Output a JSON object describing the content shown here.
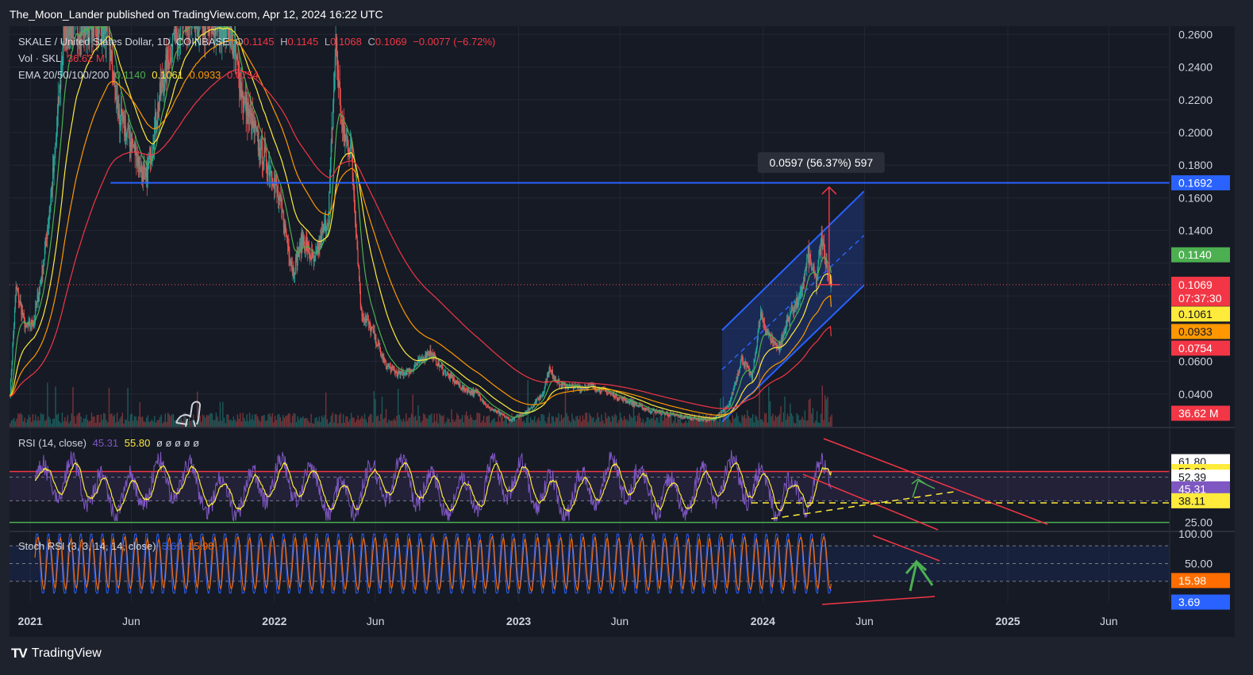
{
  "header": {
    "text": "The_Moon_Lander published on TradingView.com, Apr 12, 2024 16:22 UTC"
  },
  "footer": {
    "brand": "TradingView"
  },
  "legend": {
    "symbol": "SKALE / United States Dollar, 1D, COINBASE",
    "o_label": "O",
    "o": "0.1145",
    "h_label": "H",
    "h": "0.1145",
    "l_label": "L",
    "l": "0.1068",
    "c_label": "C",
    "c": "0.1069",
    "change": "−0.0077 (−6.72%)",
    "vol_label": "Vol · SKL",
    "vol": "36.62 M",
    "ema_label": "EMA 20/50/100/200",
    "ema20": "0.1140",
    "ema50": "0.1061",
    "ema100": "0.0933",
    "ema200": "0.0754"
  },
  "rsi_legend": {
    "label": "RSI (14, close)",
    "value": "45.31",
    "ma": "55.80",
    "empties": "ø ø ø ø ø"
  },
  "stoch_legend": {
    "label": "Stoch RSI (3, 3, 14, 14, close)",
    "k": "3.69",
    "d": "15.98"
  },
  "measure_label": "0.0597 (56.37%) 597",
  "price_tags": {
    "level": "0.1692",
    "ema20": "0.1140",
    "last": "0.1069",
    "countdown": "07:37:30",
    "ema50": "0.1061",
    "ema100": "0.0933",
    "ema200": "0.0754",
    "volume": "36.62 M"
  },
  "rsi_tags": {
    "top": "61.80",
    "ma": "55.80",
    "mid": "52.39",
    "rsi": "45.31",
    "bottom": "38.11"
  },
  "stoch_tags": {
    "d": "15.98",
    "k": "3.69"
  },
  "colors": {
    "background": "#161a25",
    "up": "#26a69a",
    "down": "#ef5350",
    "ema20": "#4caf50",
    "ema50": "#ffeb3b",
    "ema100": "#ff9800",
    "ema200": "#f23645",
    "level_line": "#2962ff",
    "channel": "#2962ff",
    "rsi_line": "#7e57c2",
    "stoch_d": "#ff6d00",
    "stoch_k": "#2962ff",
    "annotation_red": "#f23645",
    "annotation_green": "#4caf50",
    "annotation_yellow": "#ffeb3b"
  },
  "chart_data": {
    "type": "candlestick",
    "symbol": "SKALE / United States Dollar",
    "interval": "1D",
    "x_range": [
      "2020-12-01",
      "2025-08-31"
    ],
    "x_ticks": [
      "2021",
      "Jun",
      "2022",
      "Jun",
      "2023",
      "Jun",
      "2024",
      "Jun",
      "2025",
      "Jun"
    ],
    "y_range": [
      0.02,
      0.265
    ],
    "y_ticks": [
      "0.2600",
      "0.2400",
      "0.2200",
      "0.2000",
      "0.1800",
      "0.1600",
      "0.1400",
      "0.0600",
      "0.0400"
    ],
    "close_path": [
      [
        "2020-12-01",
        0.04
      ],
      [
        "2020-12-10",
        0.105
      ],
      [
        "2020-12-25",
        0.08
      ],
      [
        "2021-01-06",
        0.085
      ],
      [
        "2021-01-20",
        0.12
      ],
      [
        "2021-02-05",
        0.18
      ],
      [
        "2021-02-20",
        0.265
      ],
      [
        "2021-03-20",
        0.265
      ],
      [
        "2021-04-25",
        0.265
      ],
      [
        "2021-05-12",
        0.21
      ],
      [
        "2021-06-05",
        0.19
      ],
      [
        "2021-06-22",
        0.17
      ],
      [
        "2021-07-12",
        0.22
      ],
      [
        "2021-08-05",
        0.265
      ],
      [
        "2021-10-25",
        0.265
      ],
      [
        "2021-11-15",
        0.22
      ],
      [
        "2021-12-10",
        0.19
      ],
      [
        "2021-12-28",
        0.175
      ],
      [
        "2022-01-12",
        0.15
      ],
      [
        "2022-01-28",
        0.115
      ],
      [
        "2022-02-12",
        0.135
      ],
      [
        "2022-03-01",
        0.12
      ],
      [
        "2022-03-22",
        0.15
      ],
      [
        "2022-04-02",
        0.255
      ],
      [
        "2022-04-12",
        0.2
      ],
      [
        "2022-04-25",
        0.19
      ],
      [
        "2022-05-10",
        0.09
      ],
      [
        "2022-05-25",
        0.08
      ],
      [
        "2022-06-15",
        0.058
      ],
      [
        "2022-07-05",
        0.052
      ],
      [
        "2022-07-25",
        0.055
      ],
      [
        "2022-08-10",
        0.062
      ],
      [
        "2022-08-20",
        0.066
      ],
      [
        "2022-09-10",
        0.054
      ],
      [
        "2022-10-10",
        0.043
      ],
      [
        "2022-11-01",
        0.04
      ],
      [
        "2022-11-15",
        0.032
      ],
      [
        "2022-12-20",
        0.024
      ],
      [
        "2023-01-15",
        0.03
      ],
      [
        "2023-02-05",
        0.04
      ],
      [
        "2023-02-15",
        0.055
      ],
      [
        "2023-03-05",
        0.045
      ],
      [
        "2023-04-05",
        0.044
      ],
      [
        "2023-04-20",
        0.045
      ],
      [
        "2023-06-10",
        0.036
      ],
      [
        "2023-07-15",
        0.03
      ],
      [
        "2023-09-01",
        0.026
      ],
      [
        "2023-10-15",
        0.024
      ],
      [
        "2023-11-10",
        0.032
      ],
      [
        "2023-11-30",
        0.062
      ],
      [
        "2023-12-15",
        0.05
      ],
      [
        "2023-12-28",
        0.088
      ],
      [
        "2024-01-10",
        0.075
      ],
      [
        "2024-01-25",
        0.068
      ],
      [
        "2024-02-10",
        0.09
      ],
      [
        "2024-02-25",
        0.098
      ],
      [
        "2024-03-08",
        0.125
      ],
      [
        "2024-03-20",
        0.108
      ],
      [
        "2024-03-28",
        0.135
      ],
      [
        "2024-04-05",
        0.118
      ],
      [
        "2024-04-12",
        0.1069
      ]
    ],
    "ema": [
      {
        "name": "EMA 20",
        "last": 0.114
      },
      {
        "name": "EMA 50",
        "last": 0.1061
      },
      {
        "name": "EMA 100",
        "last": 0.0933
      },
      {
        "name": "EMA 200",
        "last": 0.0754
      }
    ],
    "horizontal_level": {
      "value": 0.1692,
      "from": "2021-05-01"
    },
    "last_price": 0.1069,
    "measure": {
      "from": 0.1069,
      "to": 0.1666,
      "label": "0.0597 (56.37%) 597",
      "date": "2024-04-09"
    },
    "channel": {
      "start": "2023-11-01",
      "end": "2024-05-31",
      "upper": [
        0.079,
        0.164
      ],
      "middle": [
        0.055,
        0.137
      ],
      "lower": [
        0.023,
        0.1065
      ]
    },
    "volume": {
      "last": "36.62 M"
    },
    "rsi": {
      "length": 14,
      "last": 45.31,
      "ma_last": 55.8,
      "levels": [
        61.8,
        52.39,
        38.11
      ],
      "y_range": [
        20,
        82
      ],
      "overbought_line": 55.8,
      "oversold_line": 25.0,
      "visible_ticks": [
        "25.00"
      ]
    },
    "stoch_rsi": {
      "params": "3, 3, 14, 14",
      "k_last": 3.69,
      "d_last": 15.98,
      "y_range": [
        -15,
        103
      ],
      "ticks": [
        "100.00",
        "50.00"
      ],
      "bands": [
        80,
        20
      ]
    }
  }
}
